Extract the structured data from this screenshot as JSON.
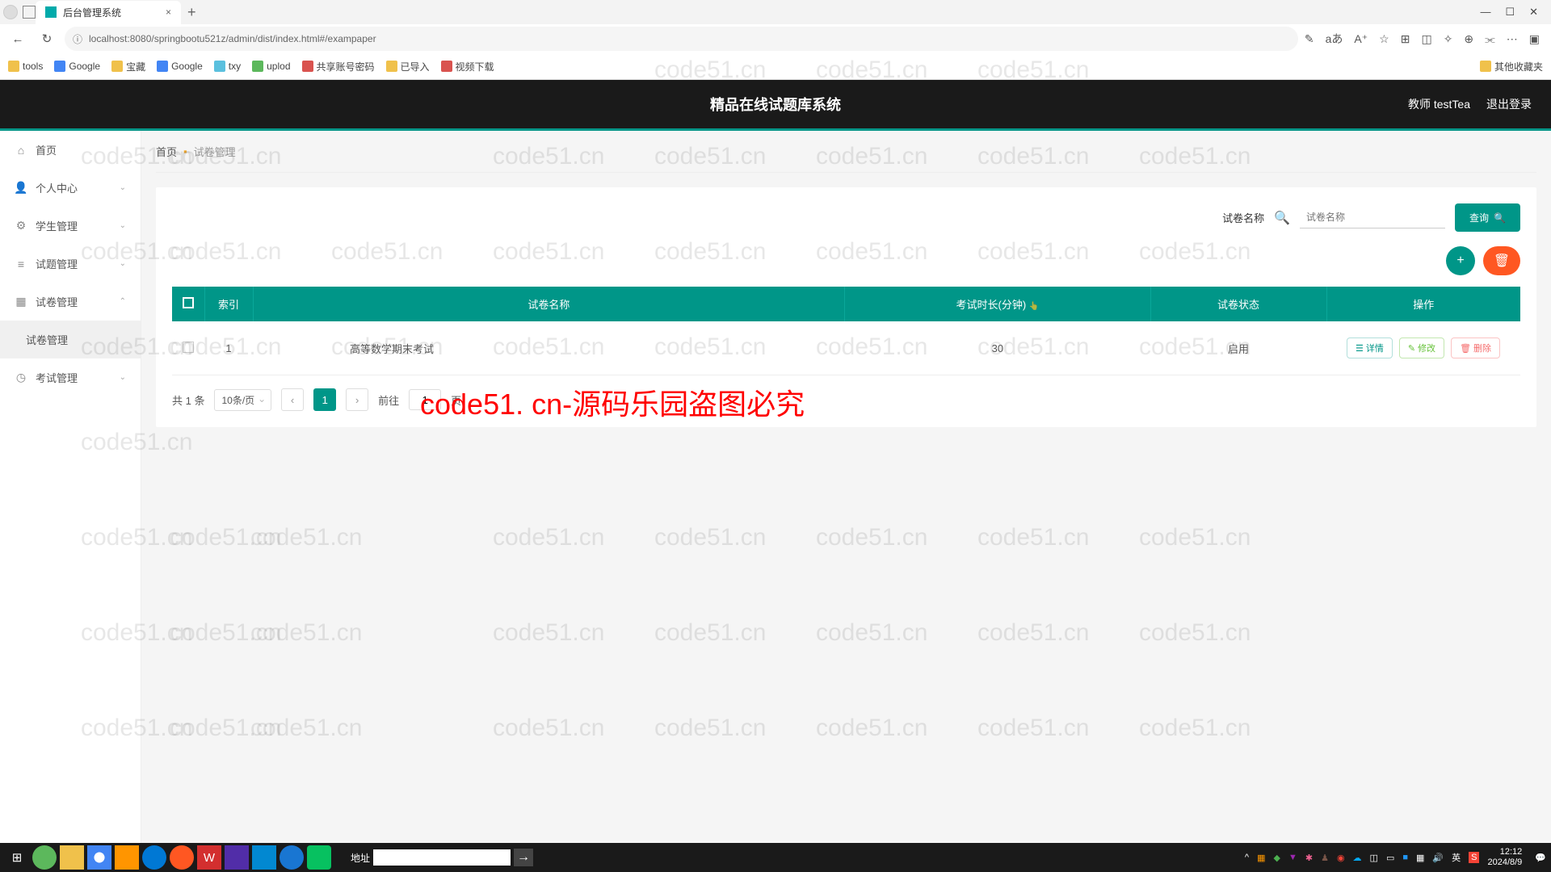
{
  "browser": {
    "tab_title": "后台管理系统",
    "url": "localhost:8080/springbootu521z/admin/dist/index.html#/exampaper",
    "bookmarks": [
      "tools",
      "Google",
      "宝藏",
      "Google",
      "txy",
      "uplod",
      "共享账号密码",
      "已导入",
      "视频下载"
    ],
    "bookmark_right": "其他收藏夹"
  },
  "header": {
    "title": "精品在线试题库系统",
    "user": "教师 testTea",
    "logout": "退出登录"
  },
  "sidebar": {
    "items": [
      {
        "icon": "home",
        "label": "首页"
      },
      {
        "icon": "user",
        "label": "个人中心",
        "chev": "down"
      },
      {
        "icon": "users",
        "label": "学生管理",
        "chev": "down"
      },
      {
        "icon": "list",
        "label": "试题管理",
        "chev": "down"
      },
      {
        "icon": "grid",
        "label": "试卷管理",
        "chev": "up"
      },
      {
        "icon": "",
        "label": "试卷管理",
        "sub": true
      },
      {
        "icon": "clock",
        "label": "考试管理",
        "chev": "down"
      }
    ]
  },
  "breadcrumb": {
    "home": "首页",
    "current": "试卷管理"
  },
  "search": {
    "label": "试卷名称",
    "placeholder": "试卷名称",
    "button": "查询"
  },
  "table": {
    "headers": [
      "",
      "索引",
      "试卷名称",
      "考试时长(分钟)",
      "试卷状态",
      "操作"
    ],
    "rows": [
      {
        "index": "1",
        "name": "高等数学期末考试",
        "duration": "30",
        "status": "启用"
      }
    ],
    "actions": {
      "detail": "详情",
      "edit": "修改",
      "delete": "删除"
    }
  },
  "pagination": {
    "total": "共 1 条",
    "per_page": "10条/页",
    "current": "1",
    "jump_prefix": "前往",
    "jump_value": "1",
    "jump_suffix": "页"
  },
  "watermark": "code51.cn",
  "watermark_red": "code51. cn-源码乐园盗图必究",
  "taskbar": {
    "addr_label": "地址",
    "time": "12:12",
    "date": "2024/8/9",
    "ime": "英"
  }
}
